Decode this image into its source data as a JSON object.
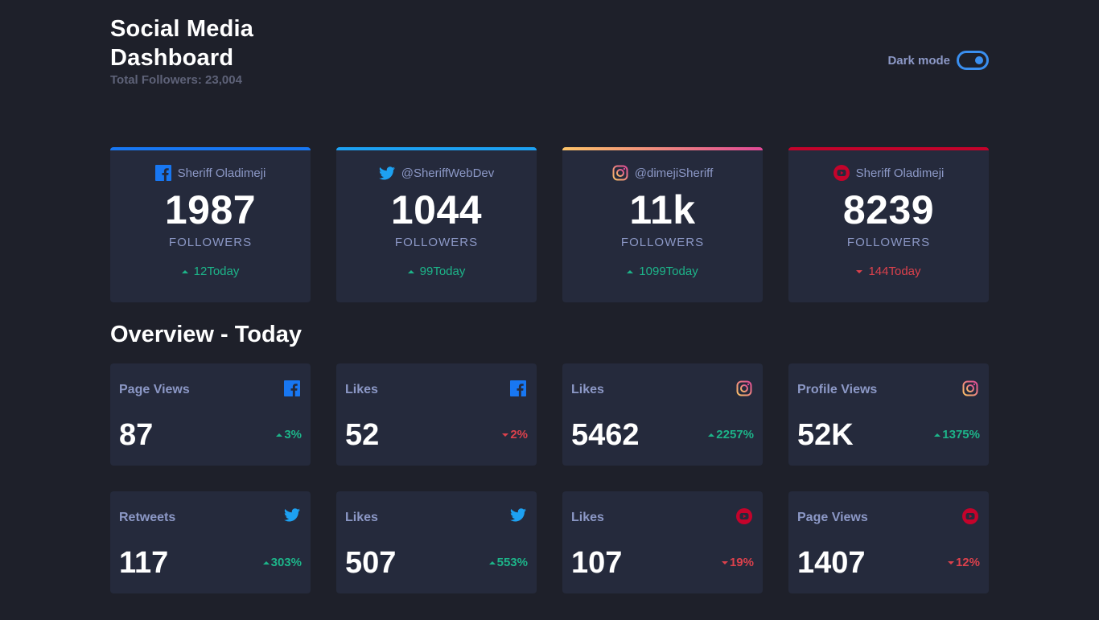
{
  "header": {
    "title": "Social Media Dashboard",
    "total_followers": "Total Followers: 23,004",
    "dark_mode_label": "Dark mode",
    "dark_mode_on": true
  },
  "colors": {
    "facebook": "#1877f2",
    "twitter": "#1da1f2",
    "instagram_gradient_start": "#fdc468",
    "instagram_gradient_end": "#df4996",
    "youtube": "#c4032b",
    "up": "#1db489",
    "down": "#dc414c"
  },
  "cards": [
    {
      "network": "facebook",
      "icon": "facebook-icon",
      "handle": "Sheriff Oladimeji",
      "count": "1987",
      "label": "FOLLOWERS",
      "delta": "12Today",
      "direction": "up"
    },
    {
      "network": "twitter",
      "icon": "twitter-icon",
      "handle": "@SheriffWebDev",
      "count": "1044",
      "label": "FOLLOWERS",
      "delta": "99Today",
      "direction": "up"
    },
    {
      "network": "instagram",
      "icon": "instagram-icon",
      "handle": "@dimejiSheriff",
      "count": "11k",
      "label": "FOLLOWERS",
      "delta": "1099Today",
      "direction": "up"
    },
    {
      "network": "youtube",
      "icon": "youtube-icon",
      "handle": "Sheriff Oladimeji",
      "count": "8239",
      "label": "FOLLOWERS",
      "delta": "144Today",
      "direction": "down"
    }
  ],
  "overview": {
    "title": "Overview - Today",
    "tiles": [
      {
        "title": "Page Views",
        "network": "facebook",
        "icon": "facebook-icon",
        "value": "87",
        "delta": "3%",
        "direction": "up"
      },
      {
        "title": "Likes",
        "network": "facebook",
        "icon": "facebook-icon",
        "value": "52",
        "delta": "2%",
        "direction": "down"
      },
      {
        "title": "Likes",
        "network": "instagram",
        "icon": "instagram-icon",
        "value": "5462",
        "delta": "2257%",
        "direction": "up"
      },
      {
        "title": "Profile Views",
        "network": "instagram",
        "icon": "instagram-icon",
        "value": "52K",
        "delta": "1375%",
        "direction": "up"
      },
      {
        "title": "Retweets",
        "network": "twitter",
        "icon": "twitter-icon",
        "value": "117",
        "delta": "303%",
        "direction": "up"
      },
      {
        "title": "Likes",
        "network": "twitter",
        "icon": "twitter-icon",
        "value": "507",
        "delta": "553%",
        "direction": "up"
      },
      {
        "title": "Likes",
        "network": "youtube",
        "icon": "youtube-icon",
        "value": "107",
        "delta": "19%",
        "direction": "down"
      },
      {
        "title": "Page Views",
        "network": "youtube",
        "icon": "youtube-icon",
        "value": "1407",
        "delta": "12%",
        "direction": "down"
      }
    ]
  }
}
